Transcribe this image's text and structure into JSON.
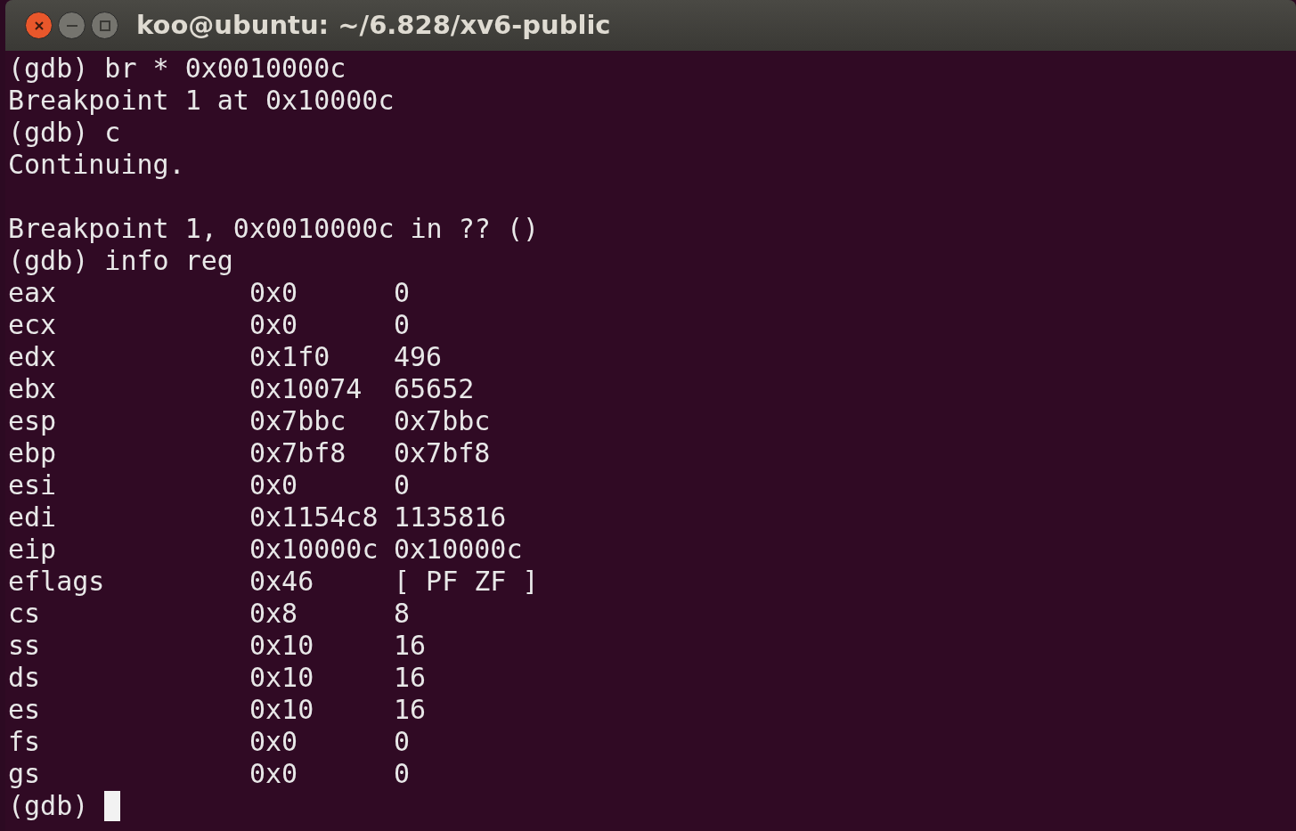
{
  "window": {
    "title": "koo@ubuntu: ~/6.828/xv6-public"
  },
  "terminal": {
    "blocks": [
      [
        "(gdb) br * 0x0010000c",
        "Breakpoint 1 at 0x10000c",
        "(gdb) c",
        "Continuing."
      ],
      [
        "Breakpoint 1, 0x0010000c in ?? ()",
        "(gdb) info reg"
      ]
    ],
    "registers": [
      {
        "name": "eax",
        "hex": "0x0",
        "value": "0"
      },
      {
        "name": "ecx",
        "hex": "0x0",
        "value": "0"
      },
      {
        "name": "edx",
        "hex": "0x1f0",
        "value": "496"
      },
      {
        "name": "ebx",
        "hex": "0x10074",
        "value": "65652"
      },
      {
        "name": "esp",
        "hex": "0x7bbc",
        "value": "0x7bbc"
      },
      {
        "name": "ebp",
        "hex": "0x7bf8",
        "value": "0x7bf8"
      },
      {
        "name": "esi",
        "hex": "0x0",
        "value": "0"
      },
      {
        "name": "edi",
        "hex": "0x1154c8",
        "value": "1135816"
      },
      {
        "name": "eip",
        "hex": "0x10000c",
        "value": "0x10000c"
      },
      {
        "name": "eflags",
        "hex": "0x46",
        "value": "[ PF ZF ]"
      },
      {
        "name": "cs",
        "hex": "0x8",
        "value": "8"
      },
      {
        "name": "ss",
        "hex": "0x10",
        "value": "16"
      },
      {
        "name": "ds",
        "hex": "0x10",
        "value": "16"
      },
      {
        "name": "es",
        "hex": "0x10",
        "value": "16"
      },
      {
        "name": "fs",
        "hex": "0x0",
        "value": "0"
      },
      {
        "name": "gs",
        "hex": "0x0",
        "value": "0"
      }
    ],
    "prompt": "(gdb)"
  }
}
